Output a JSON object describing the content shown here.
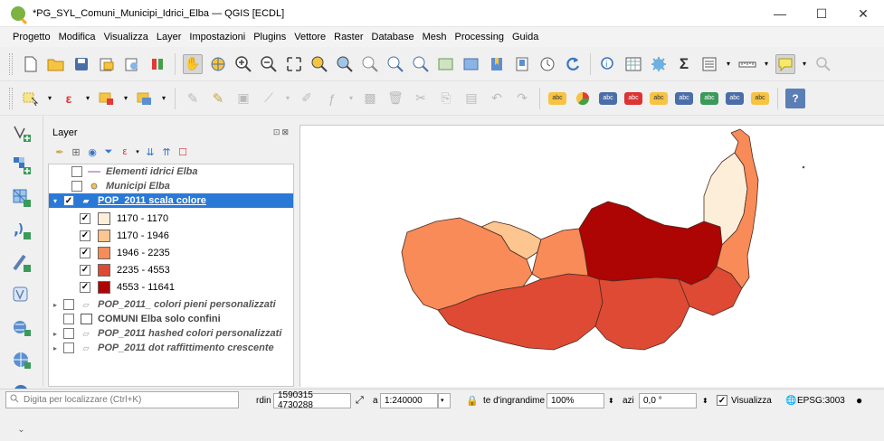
{
  "window": {
    "title": "*PG_SYL_Comuni_Municipi_Idrici_Elba — QGIS [ECDL]",
    "min": "—",
    "max": "☐",
    "close": "✕"
  },
  "menu": [
    "Progetto",
    "Modifica",
    "Visualizza",
    "Layer",
    "Impostazioni",
    "Plugins",
    "Vettore",
    "Raster",
    "Database",
    "Mesh",
    "Processing",
    "Guida"
  ],
  "layers_panel": {
    "title": "Layer",
    "controls": "⊡⊠",
    "layers": [
      {
        "name": "Elementi idrici Elba",
        "checked": false
      },
      {
        "name": "Municipi Elba",
        "checked": false
      },
      {
        "name": "POP_2011 scala colore",
        "checked": true
      },
      {
        "name": "POP_2011_ colori pieni personalizzati",
        "checked": false
      },
      {
        "name": "COMUNI Elba solo confini",
        "checked": false
      },
      {
        "name": "POP_2011 hashed colori personalizzati",
        "checked": false
      },
      {
        "name": "POP_2011 dot raffittimento crescente",
        "checked": false
      }
    ],
    "legend": [
      {
        "label": "1170 - 1170",
        "color": "#fdeed9",
        "checked": true
      },
      {
        "label": "1170 - 1946",
        "color": "#fdc58f",
        "checked": true
      },
      {
        "label": "1946 - 2235",
        "color": "#f88b58",
        "checked": true
      },
      {
        "label": "2235 - 4553",
        "color": "#de4a34",
        "checked": true
      },
      {
        "label": "4553 - 11641",
        "color": "#ad0404",
        "checked": true
      }
    ]
  },
  "status": {
    "search_placeholder": "Digita per localizzare (Ctrl+K)",
    "coord_label": "rdin",
    "coord_value": "1590315 4730288",
    "scale_label": "a",
    "scale_value": "1:240000",
    "zoom_label": "te d'ingrandime",
    "zoom_value": "100%",
    "rot_label": "azi",
    "rot_value": "0,0 °",
    "render_label": "Visualizza",
    "crs": "EPSG:3003"
  },
  "colors": {
    "selection": "#2a79d6",
    "class1": "#fdeed9",
    "class2": "#fdc58f",
    "class3": "#f88b58",
    "class4": "#de4a34",
    "class5": "#ad0404"
  }
}
